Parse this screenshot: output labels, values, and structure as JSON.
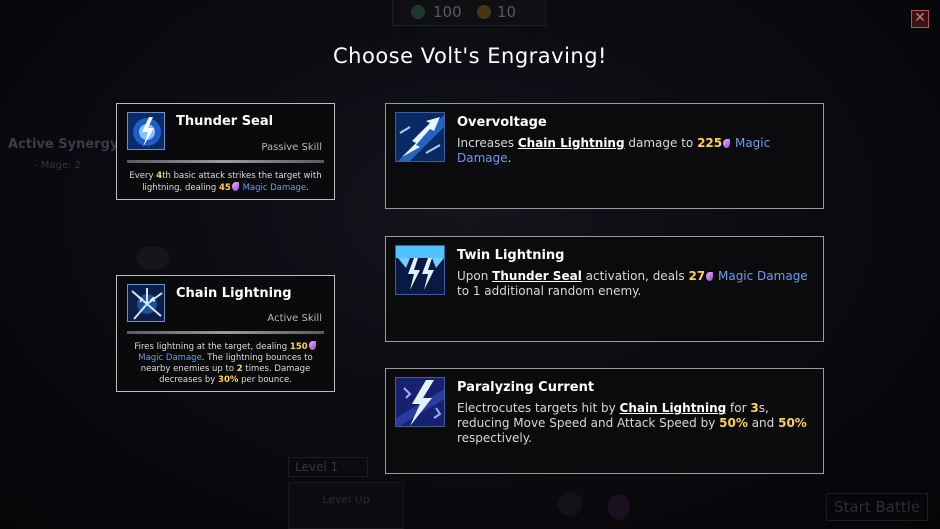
{
  "hud": {
    "gems": "100",
    "coins": "10"
  },
  "close": {
    "glyph": "✕"
  },
  "background": {
    "synergy_title": "Active Synergy",
    "synergy_item": "- Mage: 2",
    "level_label": "Level 1",
    "levelup_label": "Level Up",
    "start_label": "Start Battle"
  },
  "title": "Choose Volt's Engraving!",
  "skills": [
    {
      "icon": "thunder-seal-icon",
      "name": "Thunder Seal",
      "type": "Passive Skill",
      "desc": {
        "p1": "Every ",
        "n1": "4",
        "p2": "th basic attack strikes the target with lightning, dealing ",
        "n2": "45",
        "p3": " ",
        "m1": "Magic Damage",
        "p4": "."
      }
    },
    {
      "icon": "chain-lightning-icon",
      "name": "Chain Lightning",
      "type": "Active Skill",
      "desc": {
        "p1": "Fires lightning at the target, dealing ",
        "n1": "150",
        "m1": "Magic Damage",
        "p2": ". The lightning bounces to nearby enemies up to ",
        "n2": "2",
        "p3": " times. Damage decreases by ",
        "n3": "30%",
        "p4": " per bounce."
      }
    }
  ],
  "options": [
    {
      "icon": "overvoltage-icon",
      "name": "Overvoltage",
      "desc": {
        "p1": "Increases ",
        "u1": "Chain Lightning",
        "p2": " damage to ",
        "n1": "225",
        "m1": "Magic Damage",
        "p3": "."
      }
    },
    {
      "icon": "twin-lightning-icon",
      "name": "Twin Lightning",
      "desc": {
        "p1": "Upon ",
        "u1": "Thunder Seal",
        "p2": " activation, deals ",
        "n1": "27",
        "m1": "Magic Damage",
        "p3": " to 1 additional random enemy."
      }
    },
    {
      "icon": "paralyzing-current-icon",
      "name": "Paralyzing Current",
      "desc": {
        "p1": "Electrocutes targets hit by ",
        "u1": "Chain Lightning",
        "p2": " for ",
        "n1": "3",
        "p3": "s, reducing Move Speed and Attack Speed by ",
        "n2": "50%",
        "p4": " and ",
        "n3": "50%",
        "p5": " respectively."
      }
    }
  ],
  "colors": {
    "highlight_number": "#ffd24a",
    "magic_damage": "#6f9bf0",
    "card_border": "#bdbdbd"
  }
}
